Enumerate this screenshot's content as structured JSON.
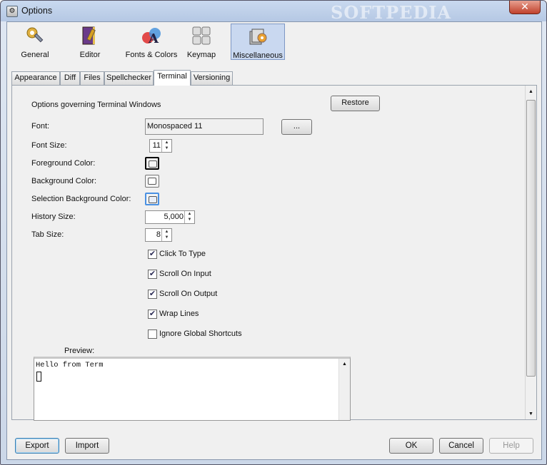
{
  "window": {
    "title": "Options",
    "watermark": "SOFTPEDIA",
    "close": "✕"
  },
  "toolbar": [
    {
      "id": "general",
      "label": "General",
      "icon": "gear-wrench-icon"
    },
    {
      "id": "editor",
      "label": "Editor",
      "icon": "book-pen-icon"
    },
    {
      "id": "fonts",
      "label": "Fonts & Colors",
      "icon": "fonts-colors-icon"
    },
    {
      "id": "keymap",
      "label": "Keymap",
      "icon": "keyboard-icon"
    },
    {
      "id": "misc",
      "label": "Miscellaneous",
      "icon": "misc-tools-icon",
      "selected": true
    }
  ],
  "tabs": [
    "Appearance",
    "Diff",
    "Files",
    "Spellchecker",
    "Terminal",
    "Versioning"
  ],
  "active_tab": "Terminal",
  "panel": {
    "heading": "Options governing Terminal Windows",
    "restore": "Restore",
    "font_label": "Font:",
    "font_value": "Monospaced 11",
    "font_browse": "...",
    "font_size_label": "Font Size:",
    "font_size_value": "11",
    "fg_label": "Foreground Color:",
    "bg_label": "Background Color:",
    "sel_bg_label": "Selection Background Color:",
    "history_label": "History Size:",
    "history_value": "5,000",
    "tab_size_label": "Tab Size:",
    "tab_size_value": "8",
    "checkboxes": [
      {
        "label": "Click To Type",
        "checked": true
      },
      {
        "label": "Scroll On Input",
        "checked": true
      },
      {
        "label": "Scroll On Output",
        "checked": true
      },
      {
        "label": "Wrap Lines",
        "checked": true
      },
      {
        "label": "Ignore Global Shortcuts",
        "checked": false
      }
    ],
    "preview_label": "Preview:",
    "preview_text": "Hello from Term"
  },
  "footer": {
    "export": "Export",
    "import": "Import",
    "ok": "OK",
    "cancel": "Cancel",
    "help": "Help"
  },
  "colors": {
    "foreground": "#000000",
    "background": "#ffffff",
    "selection": "#4a90e2"
  }
}
